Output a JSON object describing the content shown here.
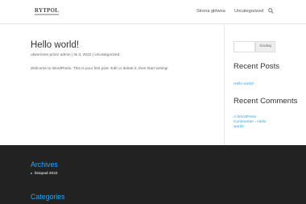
{
  "header": {
    "logo_text": "RYTPOL",
    "nav": [
      "Strona główna",
      "Uncategorized"
    ],
    "search_icon": "search-icon"
  },
  "post": {
    "title": "Hello world!",
    "meta": {
      "prefix": "utworzone przez",
      "author": "admin",
      "separator": "|",
      "date": "lis 3, 2022",
      "category": "Uncategorized"
    },
    "excerpt": "Welcome to WordPress. This is your first post. Edit or delete it, then start writing!"
  },
  "sidebar": {
    "search_button": "Szukaj",
    "recent_posts_title": "Recent Posts",
    "recent_posts": [
      "Hello world!"
    ],
    "recent_comments_title": "Recent Comments",
    "recent_comment": {
      "author": "A WordPress Commenter",
      "on": "Hello world!"
    }
  },
  "footer": {
    "archives_title": "Archives",
    "archives": [
      "listopad 2022"
    ],
    "categories_title": "Categories"
  },
  "colors": {
    "accent": "#2ea3f2",
    "footer_bg": "#222222"
  }
}
